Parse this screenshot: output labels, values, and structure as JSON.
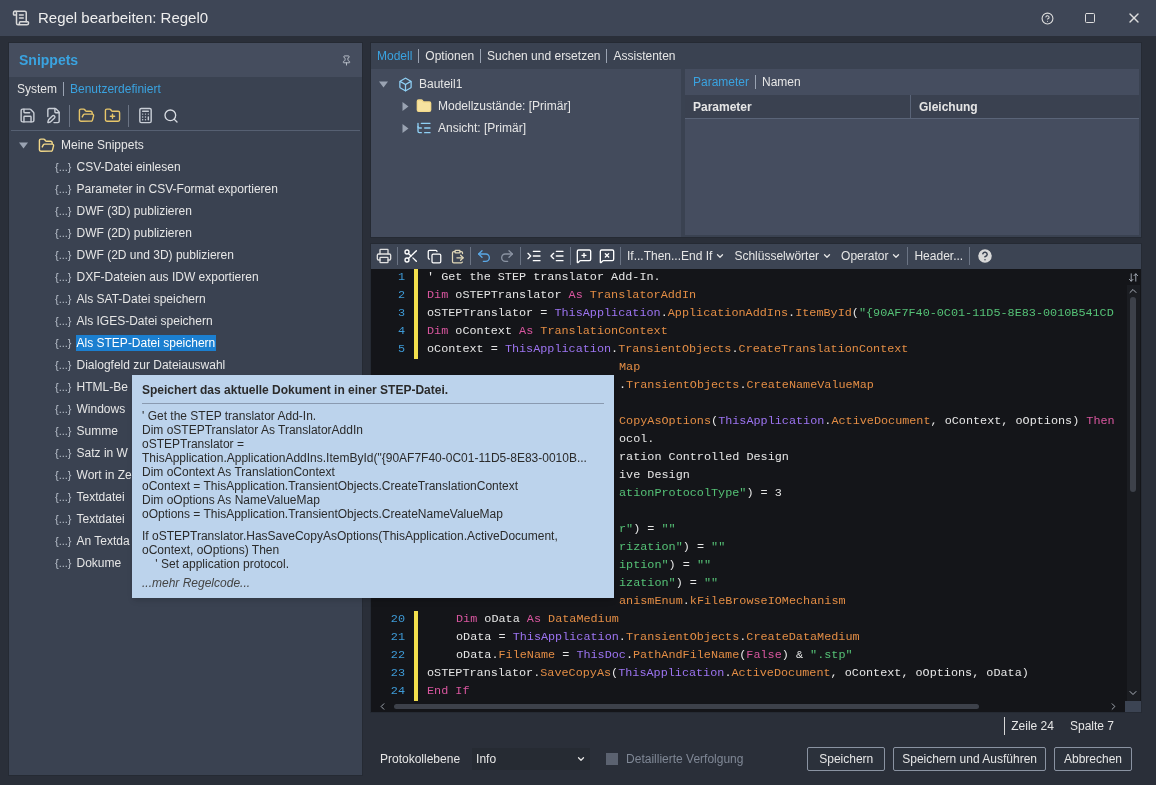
{
  "window": {
    "title": "Regel bearbeiten: Regel0"
  },
  "snippets": {
    "title": "Snippets",
    "tabs": [
      {
        "label": "System",
        "selected": false
      },
      {
        "label": "Benutzerdefiniert",
        "selected": true
      }
    ],
    "tree": {
      "label": "Meine Snippets",
      "expanded": true,
      "children": [
        {
          "icon": "{...}",
          "label": "CSV-Datei einlesen",
          "selected": false
        },
        {
          "icon": "{...}",
          "label": "Parameter in CSV-Format exportieren",
          "selected": false
        },
        {
          "icon": "{...}",
          "label": "DWF (3D) publizieren",
          "selected": false
        },
        {
          "icon": "{...}",
          "label": "DWF (2D) publizieren",
          "selected": false
        },
        {
          "icon": "{...}",
          "label": "DWF (2D und 3D) publizieren",
          "selected": false
        },
        {
          "icon": "{...}",
          "label": "DXF-Dateien aus IDW exportieren",
          "selected": false
        },
        {
          "icon": "{...}",
          "label": "Als SAT-Datei speichern",
          "selected": false
        },
        {
          "icon": "{...}",
          "label": "Als IGES-Datei speichern",
          "selected": false
        },
        {
          "icon": "{...}",
          "label": "Als STEP-Datei speichern",
          "selected": true
        },
        {
          "icon": "{...}",
          "label": "Dialogfeld zur Dateiauswahl",
          "selected": false
        },
        {
          "icon": "{...}",
          "label": "HTML-Be",
          "selected": false
        },
        {
          "icon": "{...}",
          "label": "Windows",
          "selected": false
        },
        {
          "icon": "{...}",
          "label": "Summe",
          "selected": false
        },
        {
          "icon": "{...}",
          "label": "Satz in W",
          "selected": false
        },
        {
          "icon": "{...}",
          "label": "Wort in Ze",
          "selected": false
        },
        {
          "icon": "{...}",
          "label": "Textdatei",
          "selected": false
        },
        {
          "icon": "{...}",
          "label": "Textdatei",
          "selected": false
        },
        {
          "icon": "{...}",
          "label": "An Textda",
          "selected": false
        },
        {
          "icon": "{...}",
          "label": "Dokume",
          "selected": false
        }
      ]
    }
  },
  "tooltip": {
    "title": "Speichert das aktuelle Dokument in einer STEP-Datei.",
    "blocks": [
      [
        "' Get the STEP translator Add-In.",
        "Dim oSTEPTranslator As TranslatorAddIn",
        "oSTEPTranslator =",
        "ThisApplication.ApplicationAddIns.ItemById(\"{90AF7F40-0C01-11D5-8E83-0010B...",
        "Dim oContext As TranslationContext",
        "oContext = ThisApplication.TransientObjects.CreateTranslationContext",
        "Dim oOptions As NameValueMap",
        "oOptions = ThisApplication.TransientObjects.CreateNameValueMap"
      ],
      [
        "If oSTEPTranslator.HasSaveCopyAsOptions(ThisApplication.ActiveDocument,",
        "oContext, oOptions) Then",
        "    ' Set application protocol."
      ]
    ],
    "more": "...mehr Regelcode..."
  },
  "model_tabs": [
    {
      "label": "Modell",
      "selected": true
    },
    {
      "label": "Optionen",
      "selected": false
    },
    {
      "label": "Suchen und ersetzen",
      "selected": false
    },
    {
      "label": "Assistenten",
      "selected": false
    }
  ],
  "model_tree": {
    "label": "Bauteil1",
    "expanded": true,
    "children": [
      {
        "kind": "folder",
        "label": "Modellzustände: [Primär]",
        "expanded": false
      },
      {
        "kind": "view",
        "label": "Ansicht: [Primär]",
        "expanded": false
      }
    ]
  },
  "parameters": {
    "tabs": [
      {
        "label": "Parameter",
        "selected": true
      },
      {
        "label": "Namen",
        "selected": false
      }
    ],
    "columns": [
      "Parameter",
      "Gleichung"
    ]
  },
  "editor_menus": [
    {
      "label": "If...Then...End If",
      "kind": "dropdown"
    },
    {
      "label": "Schlüsselwörter",
      "kind": "dropdown"
    },
    {
      "label": "Operator",
      "kind": "dropdown"
    },
    {
      "label": "Header...",
      "kind": "button"
    }
  ],
  "code": {
    "lines": [
      {
        "number": "1",
        "changed": true,
        "tokens": [
          {
            "kind": "txt",
            "t": "' Get the STEP translator Add-In."
          }
        ]
      },
      {
        "number": "2",
        "changed": true,
        "tokens": [
          {
            "kind": "kw",
            "t": "Dim"
          },
          {
            "kind": "txt",
            "t": " oSTEPTranslator "
          },
          {
            "kind": "kw",
            "t": "As"
          },
          {
            "kind": "mem",
            "t": " TranslatorAddIn"
          }
        ]
      },
      {
        "number": "3",
        "changed": true,
        "tokens": [
          {
            "kind": "txt",
            "t": "oSTEPTranslator = "
          },
          {
            "kind": "obj",
            "t": "ThisApplication"
          },
          {
            "kind": "txt",
            "t": "."
          },
          {
            "kind": "mem",
            "t": "ApplicationAddIns"
          },
          {
            "kind": "txt",
            "t": "."
          },
          {
            "kind": "mem",
            "t": "ItemById"
          },
          {
            "kind": "txt",
            "t": "("
          },
          {
            "kind": "str",
            "t": "\"{90AF7F40-0C01-11D5-8E83-0010B541CD"
          }
        ]
      },
      {
        "number": "4",
        "changed": true,
        "tokens": [
          {
            "kind": "kw",
            "t": "Dim"
          },
          {
            "kind": "txt",
            "t": " oContext "
          },
          {
            "kind": "kw",
            "t": "As"
          },
          {
            "kind": "mem",
            "t": " TranslationContext"
          }
        ]
      },
      {
        "number": "5",
        "changed": true,
        "tokens": [
          {
            "kind": "txt",
            "t": "oContext = "
          },
          {
            "kind": "obj",
            "t": "ThisApplication"
          },
          {
            "kind": "txt",
            "t": "."
          },
          {
            "kind": "mem",
            "t": "TransientObjects"
          },
          {
            "kind": "txt",
            "t": "."
          },
          {
            "kind": "mem",
            "t": "CreateTranslationContext"
          }
        ]
      },
      {
        "covered": true,
        "tokens": [
          {
            "kind": "mem",
            "t": "Map"
          }
        ]
      },
      {
        "covered": true,
        "tokens": [
          {
            "kind": "txt",
            "t": "."
          },
          {
            "kind": "mem",
            "t": "TransientObjects"
          },
          {
            "kind": "txt",
            "t": "."
          },
          {
            "kind": "mem",
            "t": "CreateNameValueMap"
          }
        ]
      },
      {
        "covered": true
      },
      {
        "covered": true,
        "tokens": [
          {
            "kind": "mem",
            "t": "CopyAsOptions"
          },
          {
            "kind": "txt",
            "t": "("
          },
          {
            "kind": "obj",
            "t": "ThisApplication"
          },
          {
            "kind": "txt",
            "t": "."
          },
          {
            "kind": "mem",
            "t": "ActiveDocument"
          },
          {
            "kind": "txt",
            "t": ", oContext, oOptions) "
          },
          {
            "kind": "kw",
            "t": "Then"
          }
        ]
      },
      {
        "covered": true,
        "tokens": [
          {
            "kind": "txt",
            "t": "ocol."
          }
        ]
      },
      {
        "covered": true,
        "tokens": [
          {
            "kind": "txt",
            "t": "ration Controlled Design"
          }
        ]
      },
      {
        "covered": true,
        "tokens": [
          {
            "kind": "txt",
            "t": "ive Design"
          }
        ]
      },
      {
        "covered": true,
        "tokens": [
          {
            "kind": "str",
            "t": "ationProtocolType\""
          },
          {
            "kind": "txt",
            "t": ") = 3"
          }
        ]
      },
      {
        "covered": true
      },
      {
        "covered": true,
        "tokens": [
          {
            "kind": "str",
            "t": "r\""
          },
          {
            "kind": "txt",
            "t": ") = "
          },
          {
            "kind": "str",
            "t": "\"\""
          }
        ]
      },
      {
        "covered": true,
        "tokens": [
          {
            "kind": "str",
            "t": "rization\""
          },
          {
            "kind": "txt",
            "t": ") = "
          },
          {
            "kind": "str",
            "t": "\"\""
          }
        ]
      },
      {
        "covered": true,
        "tokens": [
          {
            "kind": "str",
            "t": "iption\""
          },
          {
            "kind": "txt",
            "t": ") = "
          },
          {
            "kind": "str",
            "t": "\"\""
          }
        ]
      },
      {
        "covered": true,
        "tokens": [
          {
            "kind": "str",
            "t": "ization\""
          },
          {
            "kind": "txt",
            "t": ") = "
          },
          {
            "kind": "str",
            "t": "\"\""
          }
        ]
      },
      {
        "covered": true,
        "tokens": [
          {
            "kind": "mem",
            "t": "anismEnum"
          },
          {
            "kind": "txt",
            "t": "."
          },
          {
            "kind": "mem",
            "t": "kFileBrowseIOMechanism"
          }
        ]
      },
      {
        "number": "20",
        "changed": true,
        "indented": true,
        "tokens": [
          {
            "kind": "kw",
            "t": "Dim"
          },
          {
            "kind": "txt",
            "t": " oData "
          },
          {
            "kind": "kw",
            "t": "As"
          },
          {
            "kind": "mem",
            "t": " DataMedium"
          }
        ]
      },
      {
        "number": "21",
        "changed": true,
        "indented": true,
        "tokens": [
          {
            "kind": "txt",
            "t": "oData = "
          },
          {
            "kind": "obj",
            "t": "ThisApplication"
          },
          {
            "kind": "txt",
            "t": "."
          },
          {
            "kind": "mem",
            "t": "TransientObjects"
          },
          {
            "kind": "txt",
            "t": "."
          },
          {
            "kind": "mem",
            "t": "CreateDataMedium"
          }
        ]
      },
      {
        "number": "22",
        "changed": true,
        "indented": true,
        "tokens": [
          {
            "kind": "txt",
            "t": "oData."
          },
          {
            "kind": "mem",
            "t": "FileName"
          },
          {
            "kind": "txt",
            "t": " = "
          },
          {
            "kind": "obj",
            "t": "ThisDoc"
          },
          {
            "kind": "txt",
            "t": "."
          },
          {
            "kind": "mem",
            "t": "PathAndFileName"
          },
          {
            "kind": "txt",
            "t": "("
          },
          {
            "kind": "kw",
            "t": "False"
          },
          {
            "kind": "txt",
            "t": ") & "
          },
          {
            "kind": "str",
            "t": "\".stp\""
          }
        ]
      },
      {
        "number": "23",
        "changed": true,
        "tokens": [
          {
            "kind": "txt",
            "t": "oSTEPTranslator."
          },
          {
            "kind": "mem",
            "t": "SaveCopyAs"
          },
          {
            "kind": "txt",
            "t": "("
          },
          {
            "kind": "obj",
            "t": "ThisApplication"
          },
          {
            "kind": "txt",
            "t": "."
          },
          {
            "kind": "mem",
            "t": "ActiveDocument"
          },
          {
            "kind": "txt",
            "t": ", oContext, oOptions, oData)"
          }
        ]
      },
      {
        "number": "24",
        "changed": true,
        "tokens": [
          {
            "kind": "kw",
            "t": "End If"
          }
        ]
      }
    ]
  },
  "status": {
    "line": "Zeile 24",
    "column": "Spalte 7"
  },
  "footer": {
    "log_label": "Protokollebene",
    "log_level": "Info",
    "trace": {
      "label": "Detaillierte Verfolgung",
      "checked": false,
      "disabled": true
    },
    "buttons": [
      "Speichern",
      "Speichern und Ausführen",
      "Abbrechen"
    ]
  }
}
